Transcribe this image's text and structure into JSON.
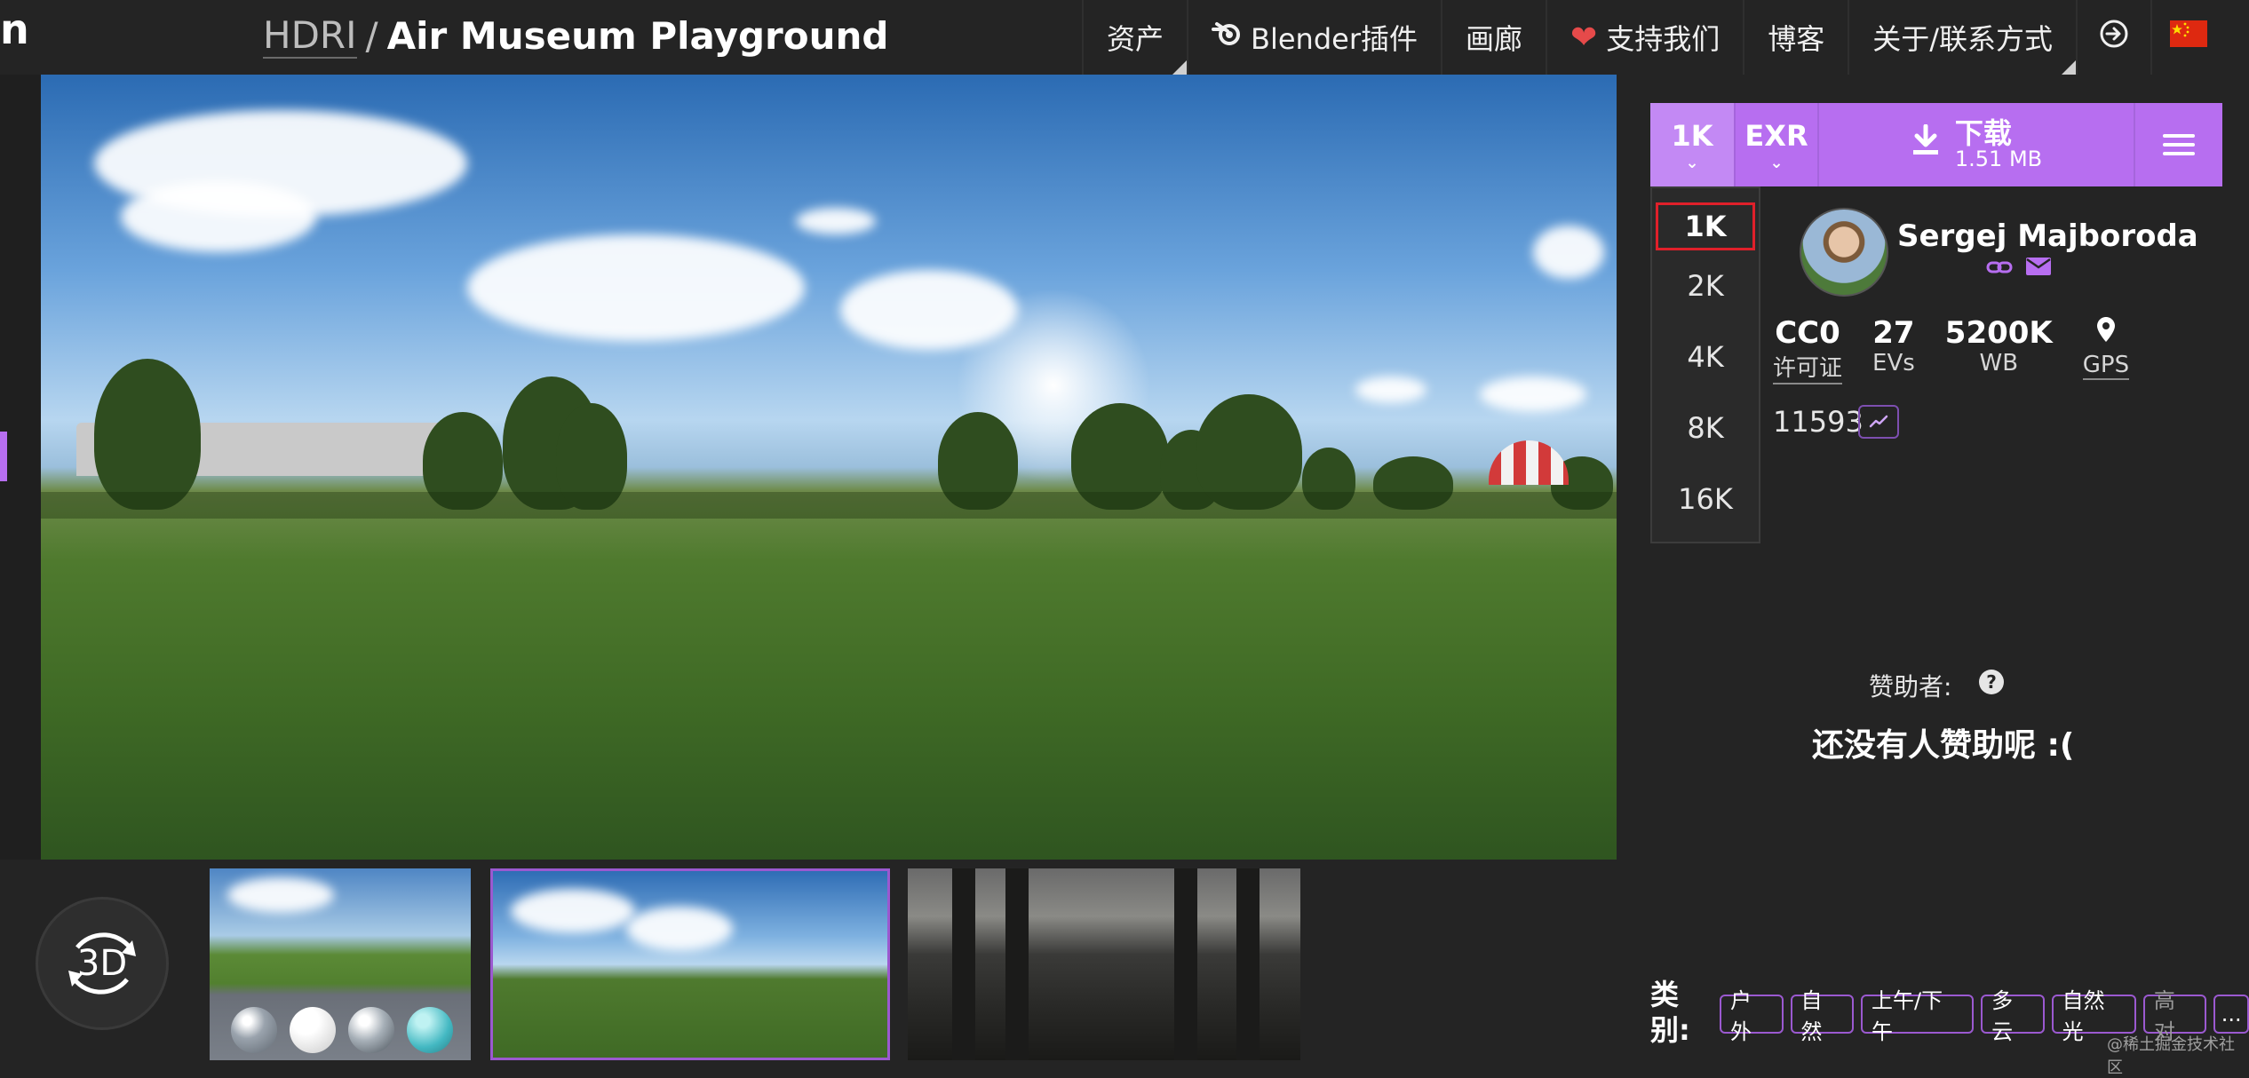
{
  "header": {
    "logo_fragment": "n",
    "breadcrumb_link": "HDRI",
    "breadcrumb_sep": "/",
    "title": "Air Museum Playground"
  },
  "nav": {
    "items": [
      {
        "label": "资产"
      },
      {
        "label": "Blender插件"
      },
      {
        "label": "画廊"
      },
      {
        "label": "支持我们"
      },
      {
        "label": "博客"
      },
      {
        "label": "关于/联系方式"
      }
    ],
    "heart_glyph": "❤"
  },
  "preview": {
    "thumb_3d_label": "3D"
  },
  "download": {
    "resolution": "1K",
    "format": "EXR",
    "label": "下载",
    "size": "1.51 MB",
    "resolution_options": [
      "1K",
      "2K",
      "4K",
      "8K",
      "16K"
    ]
  },
  "author": {
    "name": "Sergej Majboroda"
  },
  "stats": [
    {
      "value": "CC0",
      "label": "许可证"
    },
    {
      "value": "27",
      "label": "EVs"
    },
    {
      "value": "5200K",
      "label": "WB"
    },
    {
      "value": "",
      "label": "GPS"
    }
  ],
  "id_number": "11593",
  "sponsors": {
    "label": "赞助者:",
    "empty_text": "还没有人赞助呢 :("
  },
  "categories": {
    "label": "类别:",
    "tags": [
      "户外",
      "自然",
      "上午/下午",
      "多云",
      "自然光",
      "高对",
      "..."
    ]
  },
  "watermark": "@稀土掘金技术社区",
  "colors": {
    "accent": "#b76ef0",
    "accent_light": "#c389f4",
    "selected_border": "#e0202a",
    "background": "#242424"
  }
}
